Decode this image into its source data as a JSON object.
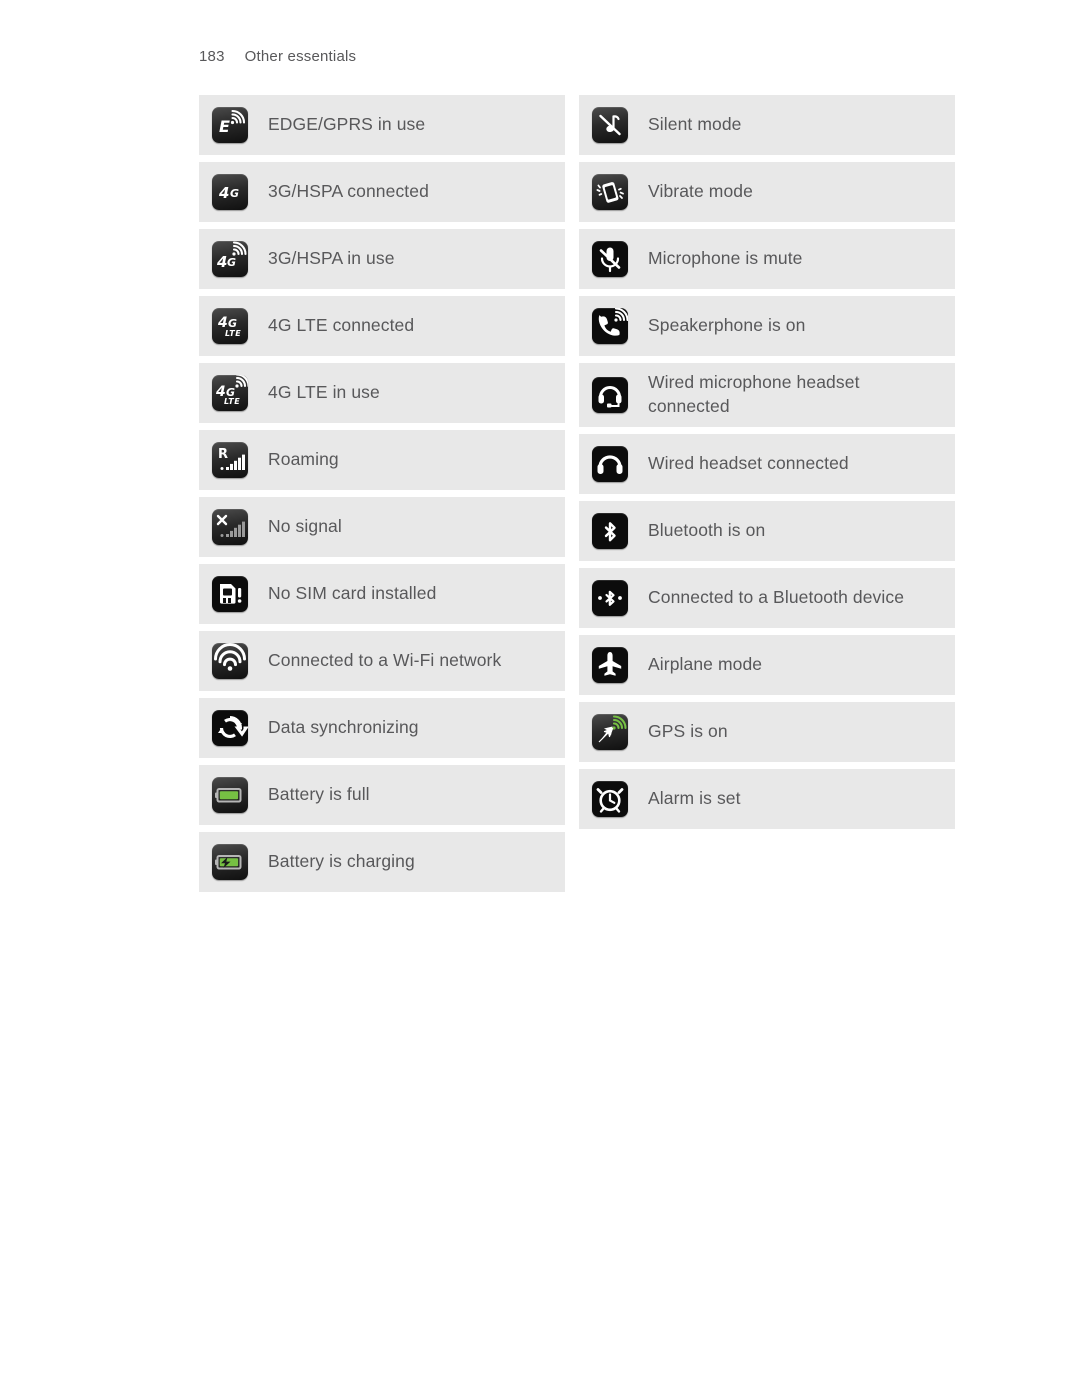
{
  "header": {
    "page_number": "183",
    "section_title": "Other essentials"
  },
  "colors": {
    "row_background": "#e8e8e8",
    "text": "#58585a",
    "page_background": "#ffffff",
    "icon_tile_dark": "#1a1a1a",
    "battery_green": "#76c043",
    "gps_green": "#76c043"
  },
  "columns": {
    "left": [
      {
        "icon": "edge-gprs-in-use-icon",
        "label": "EDGE/GPRS in use"
      },
      {
        "icon": "3g-hspa-connected-icon",
        "label": "3G/HSPA connected"
      },
      {
        "icon": "3g-hspa-in-use-icon",
        "label": "3G/HSPA in use"
      },
      {
        "icon": "4g-lte-connected-icon",
        "label": "4G LTE connected"
      },
      {
        "icon": "4g-lte-in-use-icon",
        "label": "4G LTE in use"
      },
      {
        "icon": "roaming-icon",
        "label": "Roaming"
      },
      {
        "icon": "no-signal-icon",
        "label": "No signal"
      },
      {
        "icon": "no-sim-card-icon",
        "label": "No SIM card installed"
      },
      {
        "icon": "wifi-connected-icon",
        "label": "Connected to a Wi-Fi network"
      },
      {
        "icon": "data-sync-icon",
        "label": "Data synchronizing"
      },
      {
        "icon": "battery-full-icon",
        "label": "Battery is full"
      },
      {
        "icon": "battery-charging-icon",
        "label": "Battery is charging"
      }
    ],
    "right": [
      {
        "icon": "silent-mode-icon",
        "label": "Silent mode"
      },
      {
        "icon": "vibrate-mode-icon",
        "label": "Vibrate mode"
      },
      {
        "icon": "microphone-mute-icon",
        "label": "Microphone is mute"
      },
      {
        "icon": "speakerphone-on-icon",
        "label": "Speakerphone is on"
      },
      {
        "icon": "wired-mic-headset-icon",
        "label": "Wired microphone headset\nconnected",
        "tall": true
      },
      {
        "icon": "wired-headset-icon",
        "label": "Wired headset connected"
      },
      {
        "icon": "bluetooth-on-icon",
        "label": "Bluetooth is on"
      },
      {
        "icon": "bluetooth-connected-icon",
        "label": "Connected to a Bluetooth device"
      },
      {
        "icon": "airplane-mode-icon",
        "label": "Airplane mode"
      },
      {
        "icon": "gps-on-icon",
        "label": "GPS is on"
      },
      {
        "icon": "alarm-set-icon",
        "label": "Alarm is set"
      }
    ]
  }
}
